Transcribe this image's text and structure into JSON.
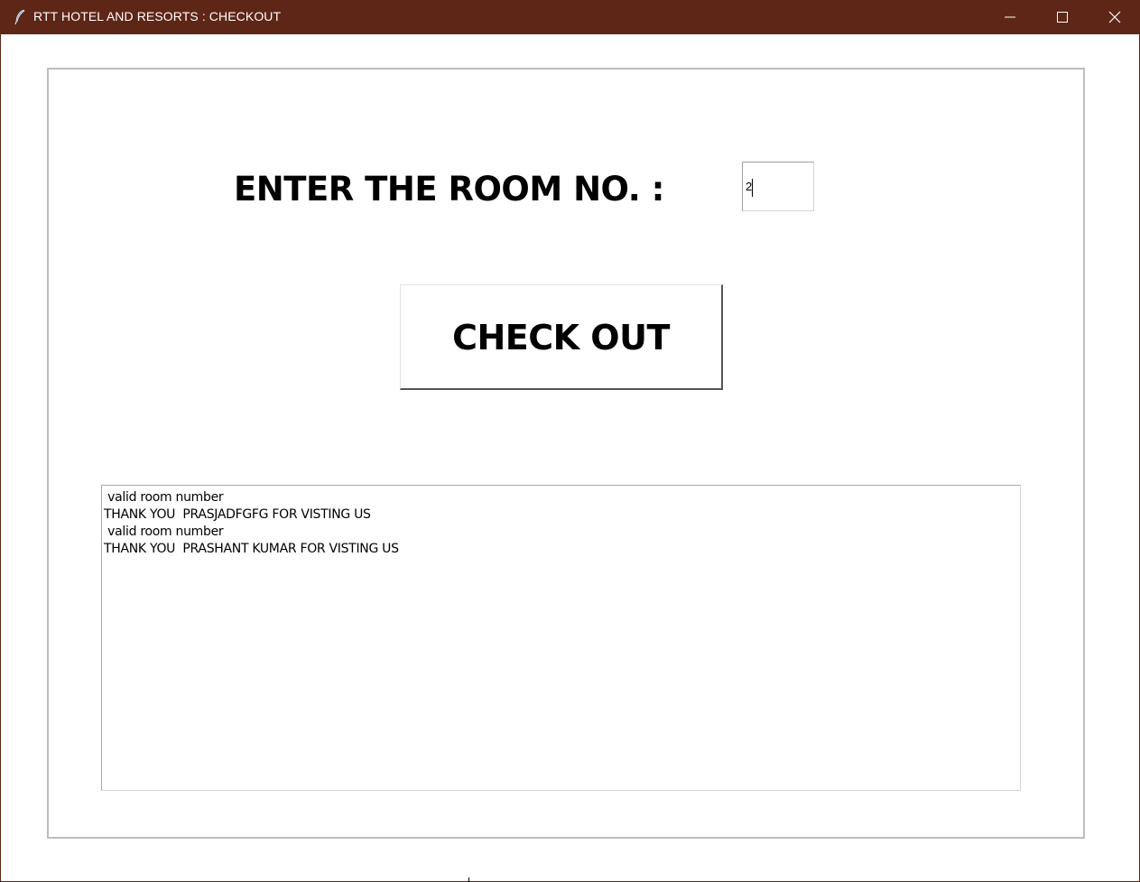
{
  "window": {
    "title": "RTT HOTEL AND RESORTS  :  CHECKOUT",
    "titlebar_color": "#5e2616",
    "controls": {
      "minimize_icon": "minimize-icon",
      "maximize_icon": "maximize-icon",
      "close_icon": "close-icon"
    },
    "app_icon": "feather-icon"
  },
  "form": {
    "room_label": "ENTER THE ROOM NO.   :",
    "room_value": "2",
    "checkout_label": "CHECK OUT"
  },
  "output": {
    "lines": [
      " valid room number",
      "THANK YOU  PRASJADFGFG FOR VISTING US",
      " valid room number",
      "THANK YOU  PRASHANT KUMAR FOR VISTING US"
    ]
  }
}
